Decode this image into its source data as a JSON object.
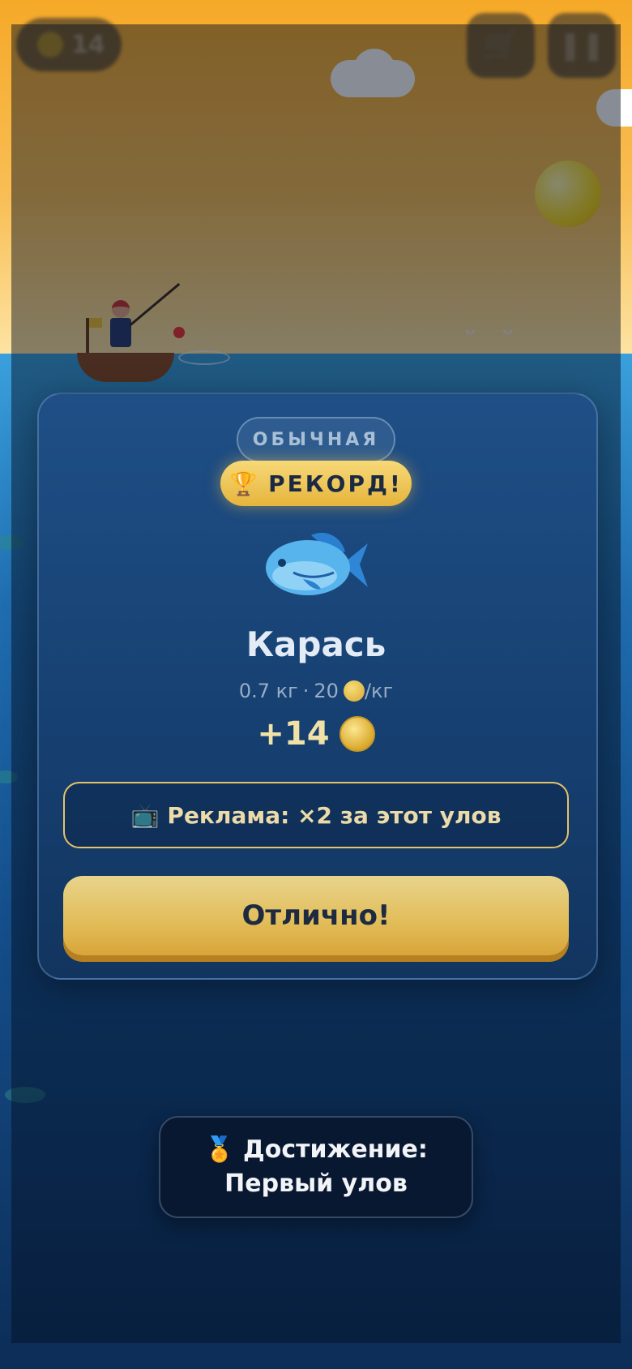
{
  "hud": {
    "coins": "14",
    "shop_icon": "cart-icon",
    "pause_icon": "pause-icon"
  },
  "catch_card": {
    "rarity": "ОБЫЧНАЯ",
    "record_icon": "🏆",
    "record_label": "РЕКОРД!",
    "fish_name": "Карась",
    "weight": "0.7 кг",
    "separator": "·",
    "price": "20",
    "price_unit": "/кг",
    "reward": "+14",
    "ad_icon": "📺",
    "ad_label": "Реклама: ×2 за этот улов",
    "ok_label": "Отлично!"
  },
  "toast": {
    "icon": "🏅",
    "line1": "Достижение:",
    "line2": "Первый улов"
  },
  "colors": {
    "accent_gold": "#e2bc58",
    "card_bg": "#163f70",
    "sky": "#f6a928",
    "sea": "#1f6db0"
  }
}
